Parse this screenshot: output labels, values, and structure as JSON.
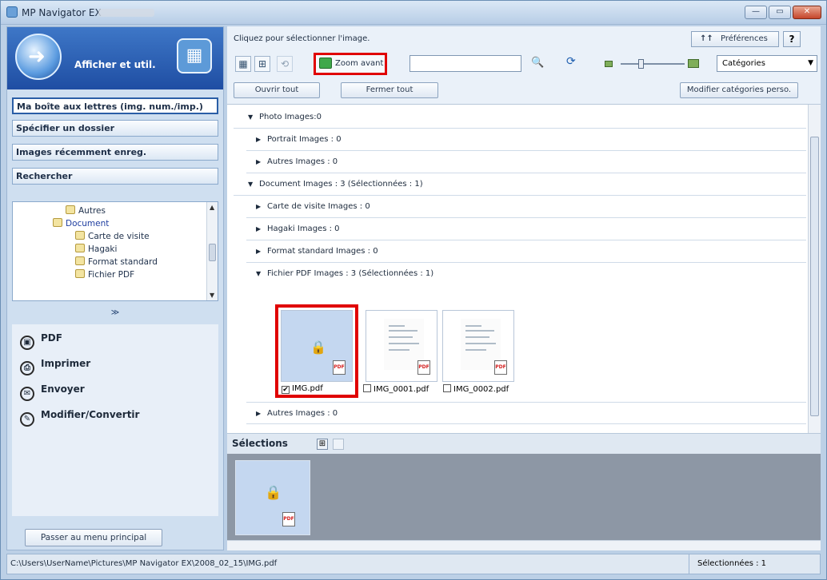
{
  "window": {
    "title": "MP Navigator EX",
    "min": "—",
    "max": "▭",
    "close": "✕"
  },
  "left": {
    "header": {
      "title": "Afficher et util."
    },
    "nav": [
      {
        "label": "Ma boîte aux lettres (img. num./imp.)"
      },
      {
        "label": "Spécifier un dossier"
      },
      {
        "label": "Images récemment enreg."
      },
      {
        "label": "Rechercher"
      }
    ],
    "tree": [
      {
        "label": "Autres"
      },
      {
        "label": "Document"
      },
      {
        "label": "Carte de visite"
      },
      {
        "label": "Hagaki"
      },
      {
        "label": "Format standard"
      },
      {
        "label": "Fichier PDF"
      }
    ],
    "collapse": "≫",
    "actions": [
      {
        "label": "PDF",
        "icon": "pdf-icon"
      },
      {
        "label": "Imprimer",
        "icon": "printer-icon"
      },
      {
        "label": "Envoyer",
        "icon": "send-icon"
      },
      {
        "label": "Modifier/Convertir",
        "icon": "edit-icon"
      }
    ],
    "main_menu": "Passer au menu principal"
  },
  "right": {
    "hint": "Cliquez pour sélectionner l'image.",
    "pref": {
      "icon": "↑↑",
      "label": "Préférences"
    },
    "help": "?",
    "zoom": "Zoom avant",
    "search_value": "",
    "category_select": "Catégories",
    "open_all": "Ouvrir tout",
    "close_all": "Fermer tout",
    "modify_cat": "Modifier catégories perso.",
    "rows": [
      {
        "label": "Photo  Images:0"
      },
      {
        "label": "Portrait   Images : 0"
      },
      {
        "label": "Autres   Images : 0"
      },
      {
        "label": "Document   Images : 3   (Sélectionnées : 1)"
      },
      {
        "label": "Carte de visite   Images : 0"
      },
      {
        "label": "Hagaki   Images : 0"
      },
      {
        "label": "Format standard   Images : 0"
      },
      {
        "label": "Fichier PDF   Images : 3   (Sélectionnées : 1)"
      },
      {
        "label": "Autres   Images : 0"
      }
    ],
    "thumbs": [
      {
        "name": "IMG.pdf",
        "checked": "✔"
      },
      {
        "name": "IMG_0001.pdf",
        "checked": ""
      },
      {
        "name": "IMG_0002.pdf",
        "checked": ""
      }
    ],
    "selections_title": "Sélections"
  },
  "status": {
    "path": "C:\\Users\\UserName\\Pictures\\MP Navigator EX\\2008_02_15\\IMG.pdf",
    "selected": "Sélectionnées : 1"
  }
}
